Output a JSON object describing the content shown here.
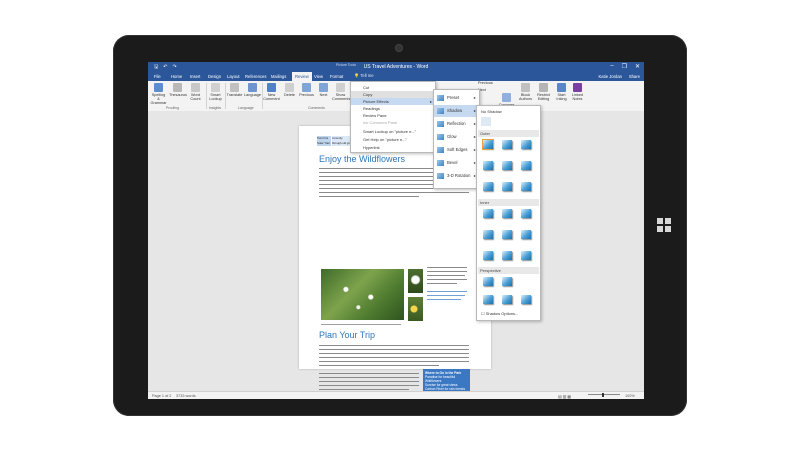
{
  "window": {
    "title": "US Travel Adventures - Word",
    "context_tab": "Picture Tools",
    "user": "Katie Jordan",
    "share": "Share"
  },
  "tabs": [
    "File",
    "Home",
    "Insert",
    "Design",
    "Layout",
    "References",
    "Mailings",
    "Review",
    "View",
    "Format"
  ],
  "active_tab": "Review",
  "tell_me": "Tell me",
  "ribbon": {
    "buttons": [
      "Spelling & Grammar",
      "Thesaurus",
      "Word Count",
      "Smart Lookup",
      "Translate",
      "Language",
      "New Comment",
      "Delete",
      "Previous",
      "Next",
      "Show Comments"
    ],
    "groups": [
      "Proofing",
      "Insights",
      "Language",
      "Comments"
    ],
    "right_buttons": [
      "Compare",
      "Block Authors",
      "Restrict Editing",
      "Start Inking",
      "Linked Notes"
    ],
    "right_small": [
      "Previous",
      "Next"
    ]
  },
  "context_menu": {
    "items": [
      "Cut",
      "Copy",
      "Picture Effects",
      "Readings",
      "Review Pane",
      "Ink Comment Pane",
      "Smart Lookup on \"picture e...\"",
      "Get Help on \"picture e...\"",
      "Hyperlink"
    ],
    "highlighted": "Picture Effects"
  },
  "effects_menu": {
    "items": [
      "Preset",
      "Shadow",
      "Reflection",
      "Glow",
      "Soft Edges",
      "Bevel",
      "3-D Rotation"
    ],
    "highlighted": "Shadow"
  },
  "shadow_gallery": {
    "no_shadow": "No Shadow",
    "sections": [
      "Outer",
      "Inner",
      "Perspective"
    ],
    "options_label": "Shadow Options..."
  },
  "document": {
    "tabs_table": [
      "Twin Firs",
      "Inmunity",
      "Solar Trail",
      "through old growth forest",
      "Longmire"
    ],
    "heading1": "Enjoy the Wildflowers",
    "heading2": "Plan Your Trip",
    "sidebar_box": "Where to Go in the Park",
    "sidebar_items": [
      "Paradise for beautiful Wildflowers",
      "Sunrise for great views",
      "Carbon River for rain forests"
    ]
  },
  "status": {
    "page": "Page 1 of 2",
    "words": "3733 words",
    "zoom": "100%"
  },
  "colors": {
    "title_bar": "#2b579a",
    "accent": "#2e75b6"
  }
}
